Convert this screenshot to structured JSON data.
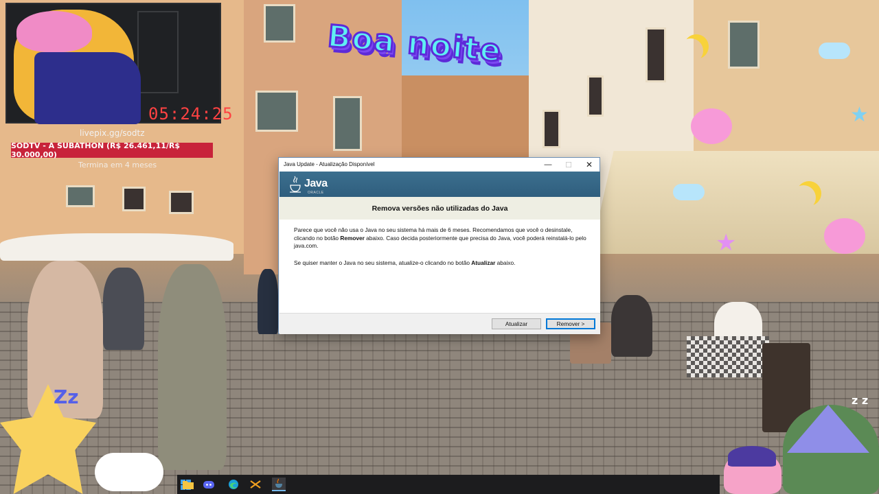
{
  "stream_overlay": {
    "timer": "05:24:25",
    "donate_link": "livepix.gg/sodtz",
    "subathon_banner": "SODTV - A SUBATHON (R$ 26.461,11/R$ 30.000,00)",
    "subathon_note": "Termina em 4 meses",
    "greeting": "Boa noite"
  },
  "dialog": {
    "window_title": "Java Update - Atualização Disponível",
    "brand": "Java",
    "brand_sub": "ORACLE",
    "heading": "Remova versões não utilizadas do Java",
    "paragraph1": {
      "part1": "Parece que você não usa o Java no seu sistema há mais de 6 meses. Recomendamos que você o desinstale, clicando no botão ",
      "bold": "Remover",
      "part2": " abaixo. Caso decida posteriormente que precisa do Java, você poderá reinstalá-lo pelo java.com."
    },
    "paragraph2": {
      "part1": "Se quiser manter o Java no seu sistema, atualize-o clicando no botão ",
      "bold": "Atualizar",
      "part2": " abaixo."
    },
    "buttons": {
      "update": "Atualizar",
      "remove": "Remover >"
    },
    "controls": {
      "minimize": "—",
      "maximize": "☐",
      "close": "✕"
    }
  },
  "taskbar": {
    "icons": [
      "start-icon",
      "file-explorer-icon",
      "discord-icon",
      "edge-icon",
      "app-icon",
      "java-updater-icon"
    ]
  },
  "colors": {
    "banner": "#2f5e7e",
    "subathon_red": "#c8233a",
    "timer_red": "#ff4242",
    "focus_blue": "#0078d7"
  }
}
